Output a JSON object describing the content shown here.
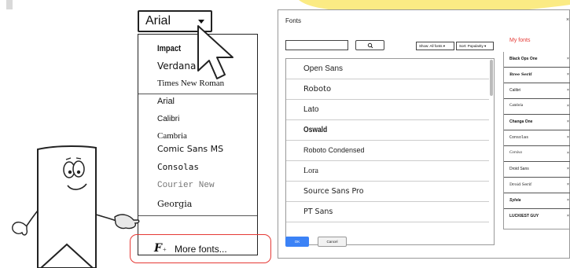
{
  "colors": {
    "accent": "#e53935",
    "ok_button": "#3b82f6",
    "swoosh": "#fbeb84",
    "mascot_hand": "#e8e8e8"
  },
  "dropdown": {
    "selected": "Arial",
    "icon": "chevron-down-icon"
  },
  "font_menu": {
    "items": [
      "Impact",
      "Verdana",
      "Times New Roman",
      "Arial",
      "Calibri",
      "Cambria",
      "Comic Sans MS",
      "Consolas",
      "Courier New",
      "Georgia"
    ],
    "more_fonts_label": "More fonts...",
    "more_fonts_icon": "F+"
  },
  "fonts_dialog": {
    "title": "Fonts",
    "close_glyph": "×",
    "search_icon": "search-icon",
    "show_filter": "Show: All fonts ▾",
    "sort_filter": "Sort: Popularity ▾",
    "font_list": [
      "Open Sans",
      "Roboto",
      "Lato",
      "Oswald",
      "Roboto Condensed",
      "Lora",
      "Source Sans Pro",
      "PT Sans"
    ],
    "my_fonts_title": "My fonts",
    "my_fonts": [
      "Black Ops One",
      "Bree Serif",
      "Calibri",
      "Cambria",
      "Changa One",
      "Consolas",
      "Corsiva",
      "Droid Sans",
      "Droid Serif",
      "Sylvia",
      "LUCKIEST GUY"
    ],
    "remove_glyph": "×",
    "ok_label": "OK",
    "cancel_label": "Cancel"
  }
}
